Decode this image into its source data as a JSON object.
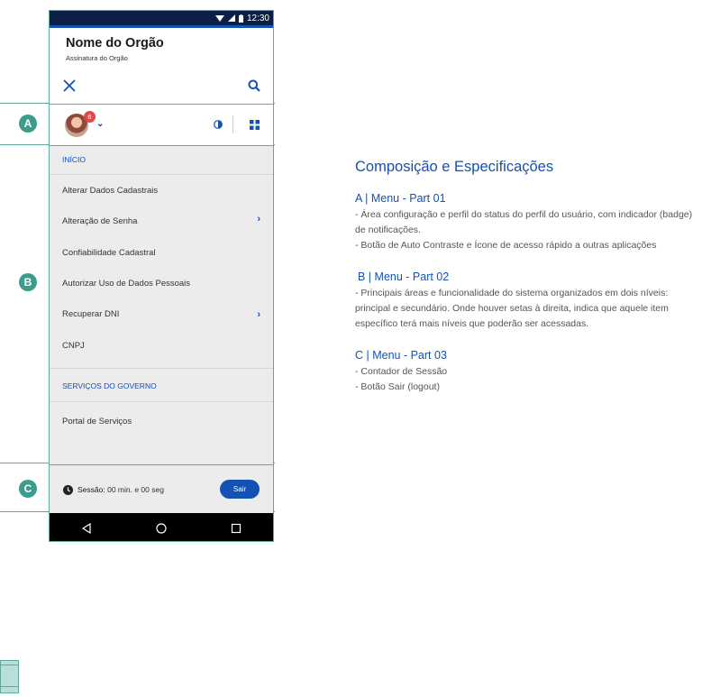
{
  "status_bar": {
    "time": "12:30"
  },
  "header": {
    "org_name": "Nome do Orgão",
    "org_subtitle": "Assinatura do Orgão"
  },
  "user_bar": {
    "badge_count": "6"
  },
  "menu": {
    "section1_title": "INÍCIO",
    "items": [
      {
        "label": "Alterar Dados Cadastrais"
      },
      {
        "label": "Alteração de Senha"
      },
      {
        "label": "Confiabilidade Cadastral"
      },
      {
        "label": "Autorizar Uso de Dados Pessoais"
      },
      {
        "label": "Recuperar DNI"
      },
      {
        "label": "CNPJ"
      }
    ],
    "section2_title": "SERVIÇOS DO GOVERNO",
    "section2_items": [
      {
        "label": "Portal de Serviços"
      }
    ]
  },
  "footer": {
    "session_label": "Sessão:",
    "session_value": "00 min. e 00 seg",
    "logout_label": "Sair"
  },
  "markers": {
    "a": "A",
    "b": "B",
    "c": "C"
  },
  "specs": {
    "title": "Composição e Especificações",
    "a_heading": "A | Menu - Part 01",
    "a_line1": "- Área configuração e perfil do status do perfil do usuário, com indicador (badge) de notificações.",
    "a_line2": "- Botão de Auto Contraste e Ícone de acesso rápido a outras aplicações",
    "b_heading": "B | Menu - Part 02",
    "b_line1": "- Principais áreas e funcionalidade do sistema organizados em dois níveis: principal e secundário. Onde houver setas à direita, indica que aquele item específico terá mais níveis que poderão ser acessadas.",
    "c_heading": "C | Menu - Part 03",
    "c_line1": "- Contador de Sessão",
    "c_line2": "- Botão Sair (logout)"
  },
  "colors": {
    "primary": "#1351b4",
    "teal": "#3d9c8e",
    "badge": "#e54848",
    "status_bar": "#0c1f45"
  }
}
